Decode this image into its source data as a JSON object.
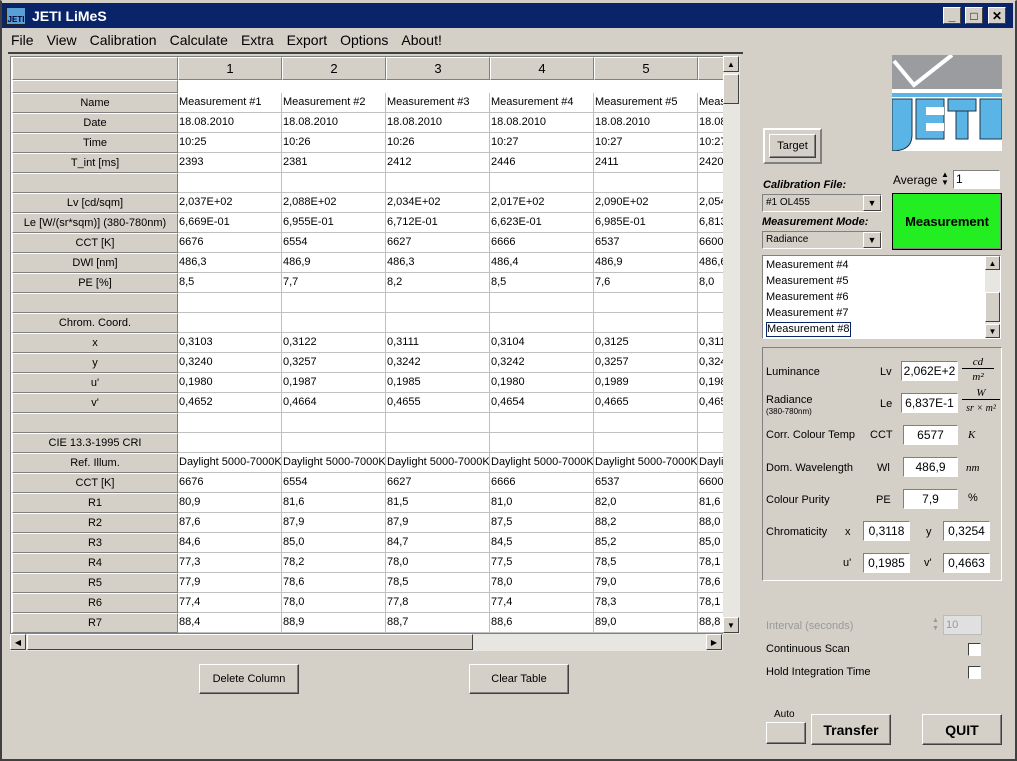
{
  "window": {
    "title": "JETI LiMeS",
    "controls": [
      "_",
      "□",
      "✕"
    ]
  },
  "menu": [
    "File",
    "View",
    "Calibration",
    "Calculate",
    "Extra",
    "Export",
    "Options",
    "About!"
  ],
  "table": {
    "columns": [
      "1",
      "2",
      "3",
      "4",
      "5",
      ""
    ],
    "rows": [
      {
        "label": "Name",
        "values": [
          "Measurement #1",
          "Measurement #2",
          "Measurement #3",
          "Measurement #4",
          "Measurement #5",
          "Meas"
        ]
      },
      {
        "label": "Date",
        "values": [
          "18.08.2010",
          "18.08.2010",
          "18.08.2010",
          "18.08.2010",
          "18.08.2010",
          "18.08"
        ]
      },
      {
        "label": "Time",
        "values": [
          "10:25",
          "10:26",
          "10:26",
          "10:27",
          "10:27",
          "10:27"
        ]
      },
      {
        "label": "T_int [ms]",
        "values": [
          "2393",
          "2381",
          "2412",
          "2446",
          "2411",
          "2420"
        ]
      },
      {
        "label": "",
        "values": [
          "",
          "",
          "",
          "",
          "",
          ""
        ]
      },
      {
        "label": "Lv [cd/sqm]",
        "values": [
          "2,037E+02",
          "2,088E+02",
          "2,034E+02",
          "2,017E+02",
          "2,090E+02",
          "2,054"
        ]
      },
      {
        "label": "Le [W/(sr*sqm)] (380-780nm)",
        "values": [
          "6,669E-01",
          "6,955E-01",
          "6,712E-01",
          "6,623E-01",
          "6,985E-01",
          "6,813"
        ]
      },
      {
        "label": "CCT [K]",
        "values": [
          "6676",
          "6554",
          "6627",
          "6666",
          "6537",
          "6600"
        ]
      },
      {
        "label": "DWl [nm]",
        "values": [
          "486,3",
          "486,9",
          "486,3",
          "486,4",
          "486,9",
          "486,6"
        ]
      },
      {
        "label": "PE [%]",
        "values": [
          "8,5",
          "7,7",
          "8,2",
          "8,5",
          "7,6",
          "8,0"
        ]
      },
      {
        "label": "",
        "values": [
          "",
          "",
          "",
          "",
          "",
          ""
        ]
      },
      {
        "label": "Chrom. Coord.",
        "values": [
          "",
          "",
          "",
          "",
          "",
          ""
        ]
      },
      {
        "label": "x",
        "values": [
          "0,3103",
          "0,3122",
          "0,3111",
          "0,3104",
          "0,3125",
          "0,311"
        ]
      },
      {
        "label": "y",
        "values": [
          "0,3240",
          "0,3257",
          "0,3242",
          "0,3242",
          "0,3257",
          "0,324"
        ]
      },
      {
        "label": "u'",
        "values": [
          "0,1980",
          "0,1987",
          "0,1985",
          "0,1980",
          "0,1989",
          "0,198"
        ]
      },
      {
        "label": "v'",
        "values": [
          "0,4652",
          "0,4664",
          "0,4655",
          "0,4654",
          "0,4665",
          "0,465"
        ]
      },
      {
        "label": "",
        "values": [
          "",
          "",
          "",
          "",
          "",
          ""
        ]
      },
      {
        "label": "CIE 13.3-1995 CRI",
        "values": [
          "",
          "",
          "",
          "",
          "",
          ""
        ]
      },
      {
        "label": "Ref. Illum.",
        "values": [
          "Daylight 5000-7000K",
          "Daylight 5000-7000K",
          "Daylight 5000-7000K",
          "Daylight 5000-7000K",
          "Daylight 5000-7000K",
          "Daylig"
        ]
      },
      {
        "label": "CCT [K]",
        "values": [
          "6676",
          "6554",
          "6627",
          "6666",
          "6537",
          "6600"
        ]
      },
      {
        "label": "R1",
        "values": [
          "80,9",
          "81,6",
          "81,5",
          "81,0",
          "82,0",
          "81,6"
        ]
      },
      {
        "label": "R2",
        "values": [
          "87,6",
          "87,9",
          "87,9",
          "87,5",
          "88,2",
          "88,0"
        ]
      },
      {
        "label": "R3",
        "values": [
          "84,6",
          "85,0",
          "84,7",
          "84,5",
          "85,2",
          "85,0"
        ]
      },
      {
        "label": "R4",
        "values": [
          "77,3",
          "78,2",
          "78,0",
          "77,5",
          "78,5",
          "78,1"
        ]
      },
      {
        "label": "R5",
        "values": [
          "77,9",
          "78,6",
          "78,5",
          "78,0",
          "79,0",
          "78,6"
        ]
      },
      {
        "label": "R6",
        "values": [
          "77,4",
          "78,0",
          "77,8",
          "77,4",
          "78,3",
          "78,1"
        ]
      },
      {
        "label": "R7",
        "values": [
          "88,4",
          "88,9",
          "88,7",
          "88,6",
          "89,0",
          "88,8"
        ]
      }
    ]
  },
  "buttons": {
    "delete_column": "Delete Column",
    "clear_table": "Clear Table",
    "target": "Target",
    "measurement": "Measurement",
    "transfer": "Transfer",
    "quit": "QUIT",
    "auto_label": "Auto"
  },
  "calibration": {
    "label": "Calibration File:",
    "value": "#1  OL455"
  },
  "mode": {
    "label": "Measurement Mode:",
    "value": "Radiance"
  },
  "average": {
    "label": "Average",
    "value": "1"
  },
  "measurement_list": [
    "Measurement #4",
    "Measurement #5",
    "Measurement #6",
    "Measurement #7",
    "Measurement #8"
  ],
  "results": {
    "luminance": {
      "label": "Luminance",
      "sym": "Lv",
      "value": "2,062E+2",
      "unit_num": "cd",
      "unit_den": "m²"
    },
    "radiance": {
      "label": "Radiance",
      "sub": "(380-780nm)",
      "sym": "Le",
      "value": "6,837E-1",
      "unit_num": "W",
      "unit_den": "sr × m²"
    },
    "cct": {
      "label": "Corr. Colour Temp",
      "sym": "CCT",
      "value": "6577",
      "unit": "K"
    },
    "dwl": {
      "label": "Dom. Wavelength",
      "sym": "Wl",
      "value": "486,9",
      "unit": "nm"
    },
    "purity": {
      "label": "Colour Purity",
      "sym": "PE",
      "value": "7,9",
      "unit": "%"
    },
    "chroma": {
      "label": "Chromaticity",
      "x_sym": "x",
      "x": "0,3118",
      "y_sym": "y",
      "y": "0,3254",
      "u_sym": "u'",
      "u": "0,1985",
      "v_sym": "v'",
      "v": "0,4663"
    }
  },
  "options": {
    "interval_label": "Interval  (seconds)",
    "interval_value": "10",
    "continuous_scan": "Continuous Scan",
    "hold_integration": "Hold Integration Time"
  },
  "colors": {
    "titlebar": "#0a246a",
    "measurement_button": "#22ee22",
    "logo_blue": "#5ab4e6",
    "logo_gray": "#9a9ca0"
  }
}
